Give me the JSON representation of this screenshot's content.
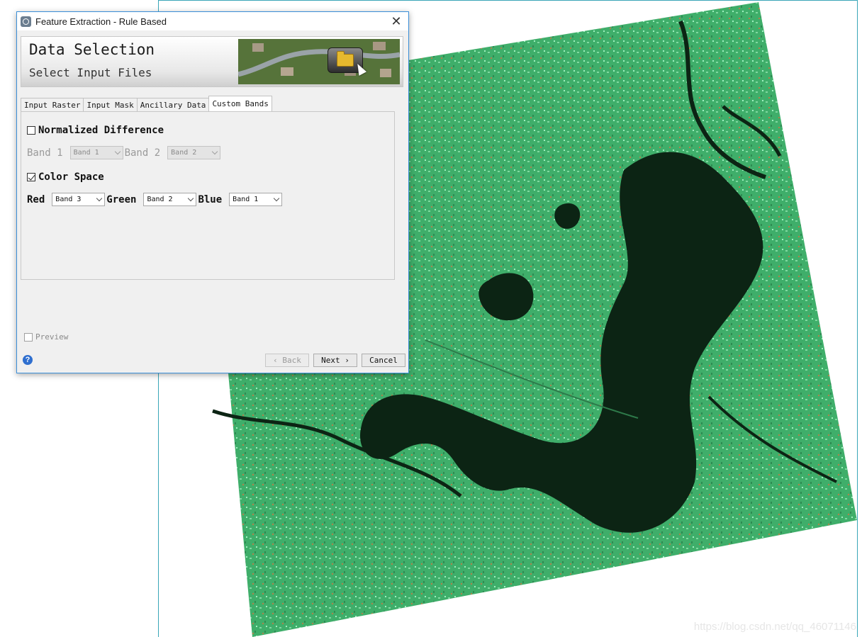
{
  "dialog": {
    "title": "Feature Extraction - Rule Based",
    "close_label": "✕"
  },
  "banner": {
    "title": "Data Selection",
    "subtitle": "Select Input Files"
  },
  "tabs": [
    {
      "label": "Input Raster",
      "active": false
    },
    {
      "label": "Input Mask",
      "active": false
    },
    {
      "label": "Ancillary Data",
      "active": false
    },
    {
      "label": "Custom Bands",
      "active": true
    }
  ],
  "normalized_difference": {
    "label": "Normalized Difference",
    "checked": false,
    "band1_label": "Band 1",
    "band1_value": "Band 1",
    "band2_label": "Band 2",
    "band2_value": "Band 2"
  },
  "color_space": {
    "label": "Color Space",
    "checked": true,
    "red_label": "Red",
    "red_value": "Band 3",
    "green_label": "Green",
    "green_value": "Band 2",
    "blue_label": "Blue",
    "blue_value": "Band 1"
  },
  "preview": {
    "label": "Preview",
    "checked": false
  },
  "buttons": {
    "back": "‹ Back",
    "next": "Next ›",
    "cancel": "Cancel"
  },
  "help_label": "?",
  "watermark": "https://blog.csdn.net/qq_46071146",
  "colors": {
    "accent": "#3b8fd8",
    "viewer_border": "#3aa6b8",
    "image_green": "#3fae6a",
    "water": "#0c2414"
  }
}
